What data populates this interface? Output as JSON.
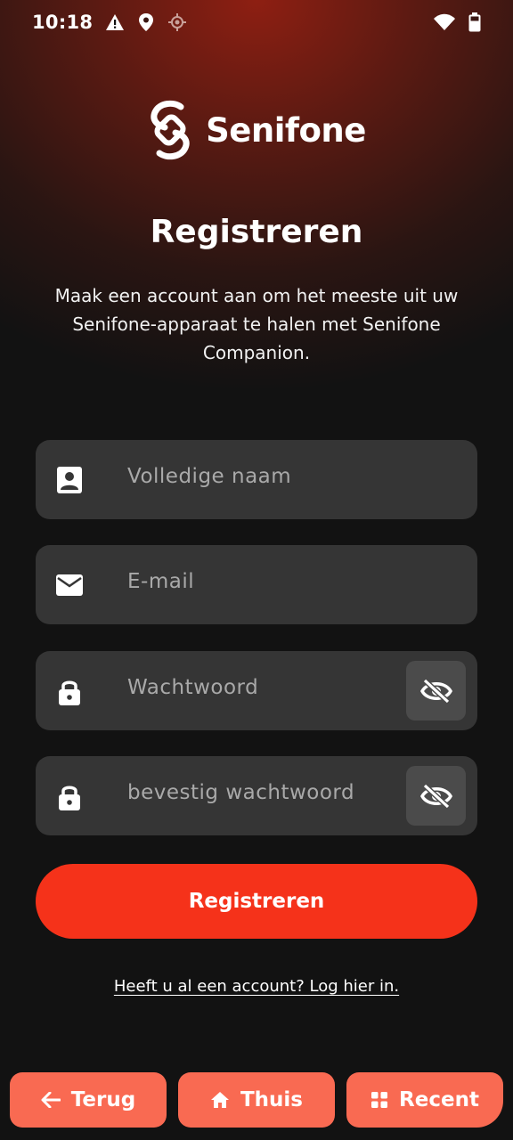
{
  "status_bar": {
    "time": "10:18",
    "icons_left": [
      "warning-icon",
      "location-pin-icon",
      "gps-icon"
    ],
    "icons_right": [
      "wifi-icon",
      "battery-icon"
    ]
  },
  "logo": {
    "text": "Senifone"
  },
  "page": {
    "title": "Registreren",
    "subtitle": "Maak een account aan om het meeste uit uw Senifone-apparaat te halen met Senifone Companion."
  },
  "form": {
    "full_name": {
      "placeholder": "Volledige naam",
      "value": "",
      "icon": "contact-card-icon"
    },
    "email": {
      "placeholder": "E-mail",
      "value": "",
      "icon": "mail-icon"
    },
    "password": {
      "placeholder": "Wachtwoord",
      "value": "",
      "icon": "lock-icon",
      "toggle_icon": "eye-off-icon"
    },
    "confirm_password": {
      "placeholder": "bevestig wachtwoord",
      "value": "",
      "icon": "lock-icon",
      "toggle_icon": "eye-off-icon"
    }
  },
  "buttons": {
    "register": "Registreren",
    "login_link": "Heeft u al een account? Log hier in."
  },
  "bottom_nav": {
    "back": {
      "label": "Terug",
      "icon": "arrow-left-icon"
    },
    "home": {
      "label": "Thuis",
      "icon": "home-icon"
    },
    "recent": {
      "label": "Recent",
      "icon": "grid-icon"
    }
  },
  "colors": {
    "accent": "#f5321a",
    "nav_button": "#f96a52",
    "field_bg": "#353535",
    "background": "#121212"
  }
}
